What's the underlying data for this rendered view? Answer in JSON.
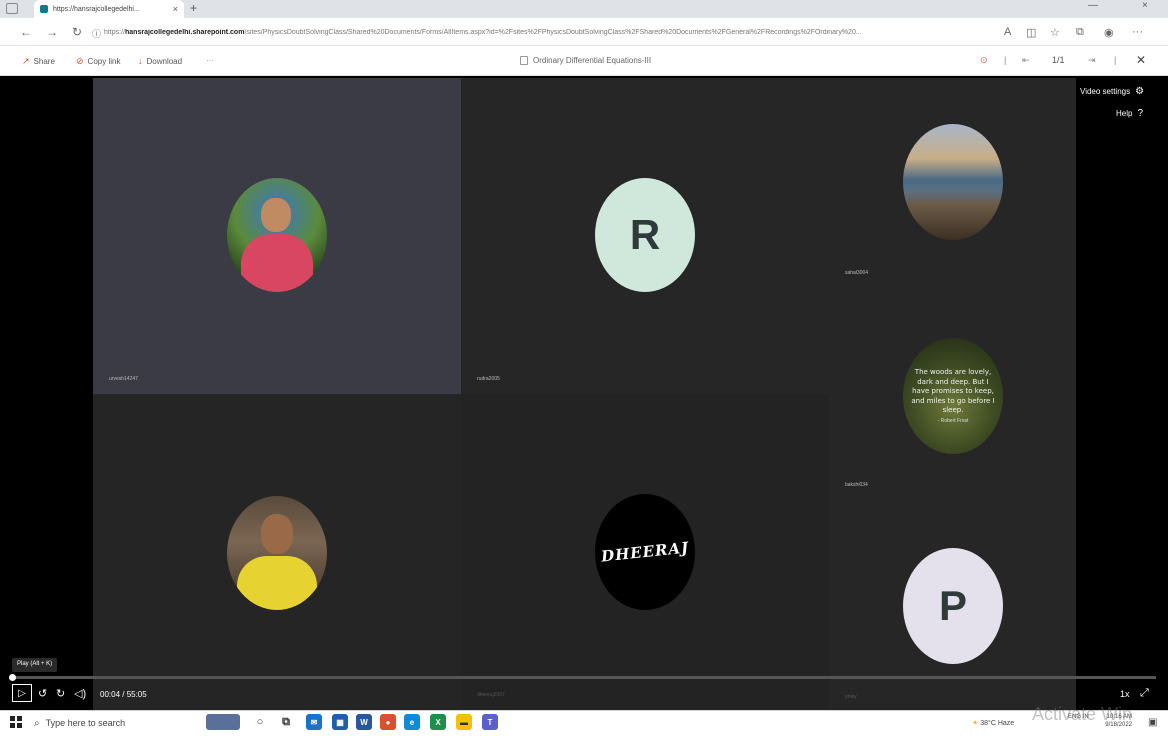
{
  "browser": {
    "tab_title": "https://hansrajcollegedelhi...",
    "url_domain": "hansrajcollegedelhi.sharepoint.com",
    "url_prefix": "https://",
    "url_rest": "/sites/PhysicsDoubtSolvingClass/Shared%20Documents/Forms/AllItems.aspx?id=%2Fsites%2FPhysicsDoubtSolvingClass%2FShared%20Documents%2FGeneral%2FRecordings%2FOrdinary%20..."
  },
  "toolbar": {
    "share_label": "Share",
    "copylink_label": "Copy link",
    "download_label": "Download",
    "more_label": "···",
    "document_title": "Ordinary Differential Equations-III",
    "page_count": "1/1"
  },
  "player": {
    "video_settings_label": "Video settings",
    "help_label": "Help",
    "tooltip": "Play (Alt + K)",
    "time": "00:04 / 55:05",
    "speed": "1x",
    "progress_fraction": 0.0012
  },
  "participants": [
    {
      "label": "urvesh14247",
      "type": "photo"
    },
    {
      "label": "rudra2005",
      "initial": "R",
      "type": "initial"
    },
    {
      "label": "sahal3004",
      "type": "photo"
    },
    {
      "label": "bakshi034",
      "type": "quote",
      "quote": "The woods are lovely, dark and deep. But I have promises to keep, and miles to go before I sleep.",
      "quote_author": "- Robert Frost"
    },
    {
      "label": "",
      "type": "photo"
    },
    {
      "label": "dheeraj2007",
      "type": "logo",
      "logo_text": "DHEERAJ"
    },
    {
      "label": "pinky",
      "initial": "P",
      "type": "initial"
    }
  ],
  "taskbar": {
    "search_placeholder": "Type here to search",
    "weather": "38°C Haze",
    "lang": "ENG IN",
    "time": "10:16 AM",
    "date": "9/18/2022",
    "watermark": "Activate Win"
  },
  "colors": {
    "accent": "#d64f2a",
    "tile_bg": "#2b2b2b",
    "tile_bg_selected": "#3a3b45",
    "initial_r_bg": "#cfe8db",
    "initial_p_bg": "#e4e1ec"
  }
}
